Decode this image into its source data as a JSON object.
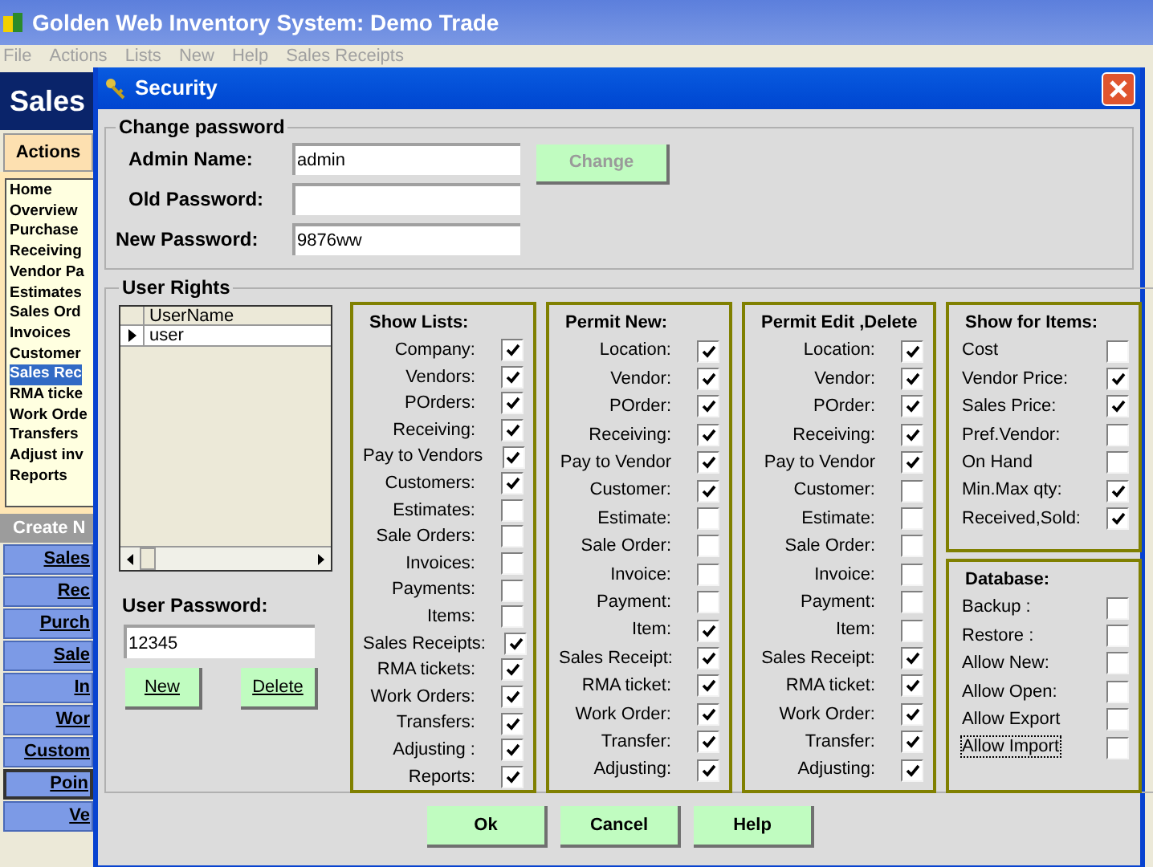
{
  "app": {
    "title": "Golden Web Inventory System: Demo Trade",
    "menu": [
      {
        "label": "File"
      },
      {
        "label": "Actions"
      },
      {
        "label": "Lists"
      },
      {
        "label": "New"
      },
      {
        "label": "Help"
      },
      {
        "label": "Sales Receipts"
      }
    ],
    "header": "Sales",
    "sidebar": {
      "tab": "Actions",
      "items": [
        {
          "label": "Home",
          "selected": false
        },
        {
          "label": "Overview",
          "selected": false
        },
        {
          "label": "Purchase",
          "selected": false
        },
        {
          "label": "Receiving",
          "selected": false
        },
        {
          "label": "Vendor Pa",
          "selected": false
        },
        {
          "label": "Estimates",
          "selected": false
        },
        {
          "label": "Sales Ord",
          "selected": false
        },
        {
          "label": "Invoices",
          "selected": false
        },
        {
          "label": "Customer",
          "selected": false
        },
        {
          "label": "Sales Rec",
          "selected": true
        },
        {
          "label": "RMA ticke",
          "selected": false
        },
        {
          "label": "Work Orde",
          "selected": false
        },
        {
          "label": "Transfers",
          "selected": false
        },
        {
          "label": "Adjust inv",
          "selected": false
        },
        {
          "label": "Reports",
          "selected": false
        }
      ],
      "create_header": "Create N",
      "create_buttons": [
        {
          "label": "Sales",
          "selected": false
        },
        {
          "label": "Rec",
          "selected": false
        },
        {
          "label": "Purch",
          "selected": false
        },
        {
          "label": "Sale",
          "selected": false
        },
        {
          "label": "In",
          "selected": false
        },
        {
          "label": "Wor",
          "selected": false
        },
        {
          "label": "Custom",
          "selected": false
        },
        {
          "label": "Poin",
          "selected": true
        },
        {
          "label": "Ve",
          "selected": false
        }
      ]
    }
  },
  "dialog": {
    "title": "Security",
    "change_password": {
      "legend": "Change password",
      "fields": [
        {
          "label": "Admin Name:",
          "value": "admin"
        },
        {
          "label": "Old Password:"
        },
        {
          "label": "New Password:",
          "value": "9876ww"
        }
      ],
      "button": {
        "label": "Change",
        "disabled": true
      }
    },
    "user_rights": {
      "legend": "User Rights",
      "grid": {
        "column": "UserName",
        "rows": [
          {
            "name": "user",
            "selected": true
          }
        ]
      },
      "password_label": "User Password:",
      "password_value": "12345",
      "buttons": [
        {
          "label": "New"
        },
        {
          "label": "Delete"
        }
      ],
      "panels": [
        {
          "title": "Show Lists:",
          "items": [
            {
              "label": "Company:",
              "checked": true
            },
            {
              "label": "Vendors:",
              "checked": true
            },
            {
              "label": "POrders:",
              "checked": true
            },
            {
              "label": "Receiving:",
              "checked": true
            },
            {
              "label": "Pay to Vendors",
              "checked": true
            },
            {
              "label": "Customers:",
              "checked": true
            },
            {
              "label": "Estimates:",
              "checked": false
            },
            {
              "label": "Sale Orders:",
              "checked": false
            },
            {
              "label": "Invoices:",
              "checked": false
            },
            {
              "label": "Payments:",
              "checked": false
            },
            {
              "label": "Items:",
              "checked": false
            },
            {
              "label": "Sales Receipts:",
              "checked": true
            },
            {
              "label": "RMA tickets:",
              "checked": true
            },
            {
              "label": "Work Orders:",
              "checked": true
            },
            {
              "label": "Transfers:",
              "checked": true
            },
            {
              "label": "Adjusting :",
              "checked": true
            },
            {
              "label": "Reports:",
              "checked": true
            }
          ]
        },
        {
          "title": "Permit New:",
          "items": [
            {
              "label": "Location:",
              "checked": true
            },
            {
              "label": "Vendor:",
              "checked": true
            },
            {
              "label": "POrder:",
              "checked": true
            },
            {
              "label": "Receiving:",
              "checked": true
            },
            {
              "label": "Pay to Vendor",
              "checked": true
            },
            {
              "label": "Customer:",
              "checked": true
            },
            {
              "label": "Estimate:",
              "checked": false
            },
            {
              "label": "Sale Order:",
              "checked": false
            },
            {
              "label": "Invoice:",
              "checked": false
            },
            {
              "label": "Payment:",
              "checked": false
            },
            {
              "label": "Item:",
              "checked": true
            },
            {
              "label": "Sales Receipt:",
              "checked": true
            },
            {
              "label": "RMA ticket:",
              "checked": true
            },
            {
              "label": "Work Order:",
              "checked": true
            },
            {
              "label": "Transfer:",
              "checked": true
            },
            {
              "label": "Adjusting:",
              "checked": true
            }
          ]
        },
        {
          "title": "Permit Edit ,Delete",
          "items": [
            {
              "label": "Location:",
              "checked": true
            },
            {
              "label": "Vendor:",
              "checked": true
            },
            {
              "label": "POrder:",
              "checked": true
            },
            {
              "label": "Receiving:",
              "checked": true
            },
            {
              "label": "Pay to Vendor",
              "checked": true
            },
            {
              "label": "Customer:",
              "checked": false
            },
            {
              "label": "Estimate:",
              "checked": false
            },
            {
              "label": "Sale Order:",
              "checked": false
            },
            {
              "label": "Invoice:",
              "checked": false
            },
            {
              "label": "Payment:",
              "checked": false
            },
            {
              "label": "Item:",
              "checked": false
            },
            {
              "label": "Sales Receipt:",
              "checked": true
            },
            {
              "label": "RMA ticket:",
              "checked": true
            },
            {
              "label": "Work Order:",
              "checked": true
            },
            {
              "label": "Transfer:",
              "checked": true
            },
            {
              "label": "Adjusting:",
              "checked": true
            }
          ]
        }
      ],
      "show_for_items": {
        "title": "Show for Items:",
        "items": [
          {
            "label": "Cost",
            "checked": false
          },
          {
            "label": "Vendor Price:",
            "checked": true
          },
          {
            "label": "Sales Price:",
            "checked": true
          },
          {
            "label": "Pref.Vendor:",
            "checked": false
          },
          {
            "label": "On Hand",
            "checked": false
          },
          {
            "label": "Min.Max qty:",
            "checked": true
          },
          {
            "label": "Received,Sold:",
            "checked": true
          }
        ]
      },
      "database": {
        "title": "Database:",
        "items": [
          {
            "label": "Backup :",
            "checked": false,
            "focused": false
          },
          {
            "label": "Restore :",
            "checked": false,
            "focused": false
          },
          {
            "label": "Allow New:",
            "checked": false,
            "focused": false
          },
          {
            "label": "Allow Open:",
            "checked": false,
            "focused": false
          },
          {
            "label": "Allow Export",
            "checked": false,
            "focused": false
          },
          {
            "label": "Allow Import",
            "checked": false,
            "focused": true
          }
        ]
      }
    },
    "buttons": [
      {
        "label": "Ok"
      },
      {
        "label": "Cancel"
      },
      {
        "label": "Help"
      }
    ]
  }
}
